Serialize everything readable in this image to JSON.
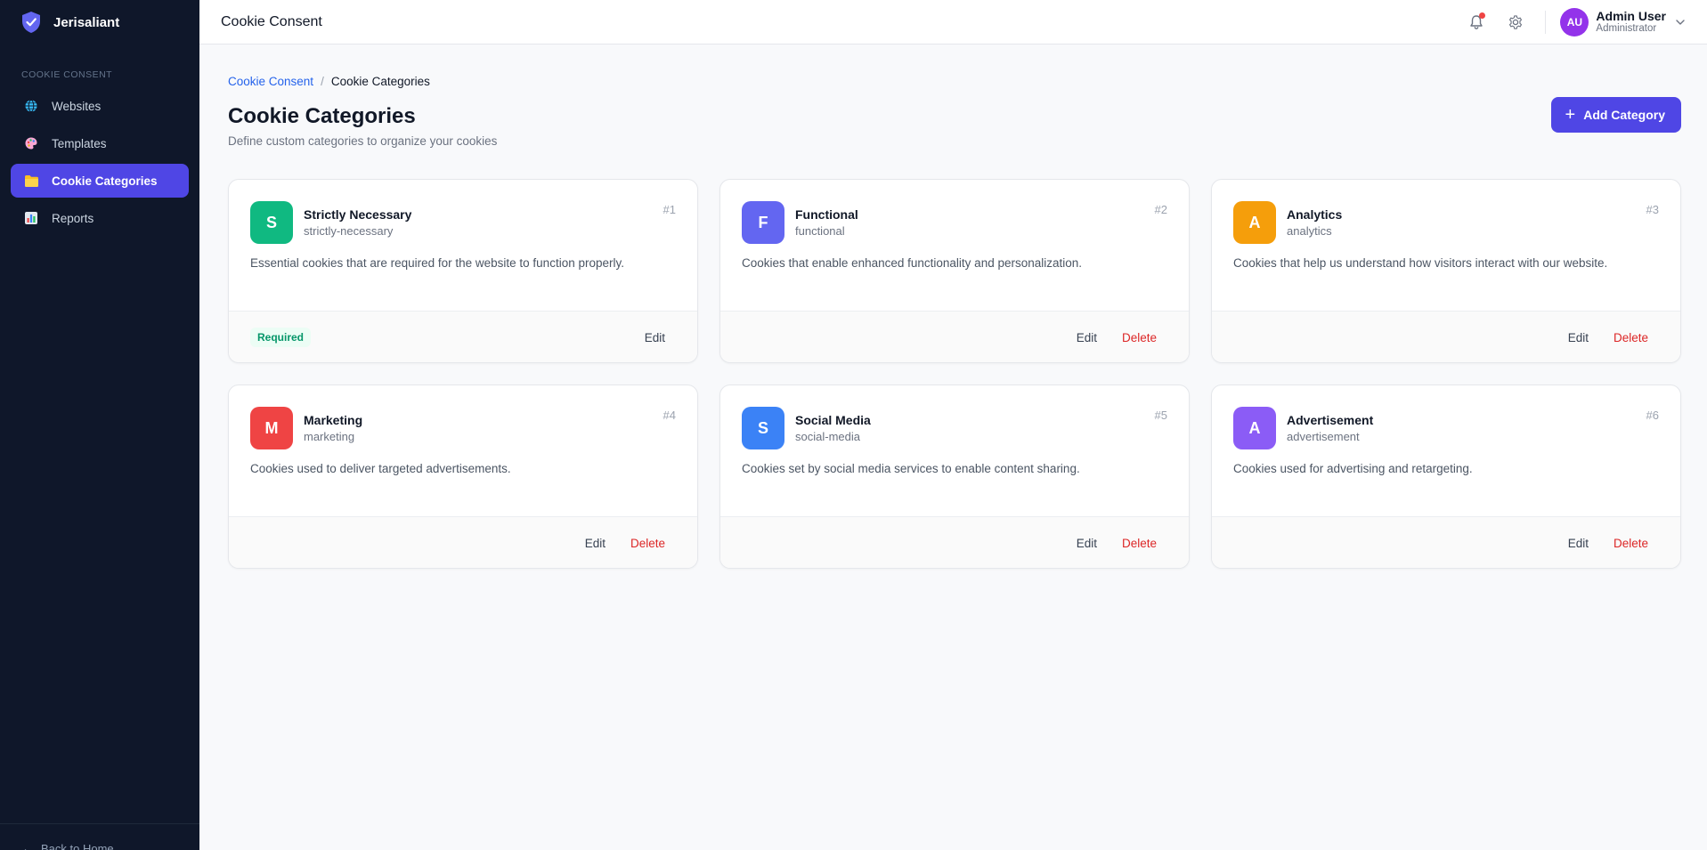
{
  "brand": {
    "name": "Jerisaliant",
    "icon": "shield-check-icon",
    "color": "#6366f1"
  },
  "sidebar": {
    "section_label": "COOKIE CONSENT",
    "items": [
      {
        "label": "Websites",
        "icon": "globe-icon",
        "active": false
      },
      {
        "label": "Templates",
        "icon": "palette-icon",
        "active": false
      },
      {
        "label": "Cookie Categories",
        "icon": "folder-icon",
        "active": true
      },
      {
        "label": "Reports",
        "icon": "bar-chart-icon",
        "active": false
      }
    ],
    "footer_link": "Back to Home"
  },
  "topbar": {
    "title": "Cookie Consent",
    "user": {
      "initials": "AU",
      "name": "Admin User",
      "role": "Administrator"
    }
  },
  "breadcrumb": {
    "root": "Cookie Consent",
    "separator": "/",
    "current": "Cookie Categories"
  },
  "page": {
    "title": "Cookie Categories",
    "subtitle": "Define custom categories to organize your cookies",
    "add_button": "Add Category"
  },
  "actions": {
    "edit": "Edit",
    "delete": "Delete",
    "required": "Required"
  },
  "categories": [
    {
      "initial": "S",
      "name": "Strictly Necessary",
      "slug": "strictly-necessary",
      "number": "#1",
      "description": "Essential cookies that are required for the website to function properly.",
      "color": "#10b981",
      "required": true
    },
    {
      "initial": "F",
      "name": "Functional",
      "slug": "functional",
      "number": "#2",
      "description": "Cookies that enable enhanced functionality and personalization.",
      "color": "#6366f1",
      "required": false
    },
    {
      "initial": "A",
      "name": "Analytics",
      "slug": "analytics",
      "number": "#3",
      "description": "Cookies that help us understand how visitors interact with our website.",
      "color": "#f59e0b",
      "required": false
    },
    {
      "initial": "M",
      "name": "Marketing",
      "slug": "marketing",
      "number": "#4",
      "description": "Cookies used to deliver targeted advertisements.",
      "color": "#ef4444",
      "required": false
    },
    {
      "initial": "S",
      "name": "Social Media",
      "slug": "social-media",
      "number": "#5",
      "description": "Cookies set by social media services to enable content sharing.",
      "color": "#3b82f6",
      "required": false
    },
    {
      "initial": "A",
      "name": "Advertisement",
      "slug": "advertisement",
      "number": "#6",
      "description": "Cookies used for advertising and retargeting.",
      "color": "#8b5cf6",
      "required": false
    }
  ]
}
